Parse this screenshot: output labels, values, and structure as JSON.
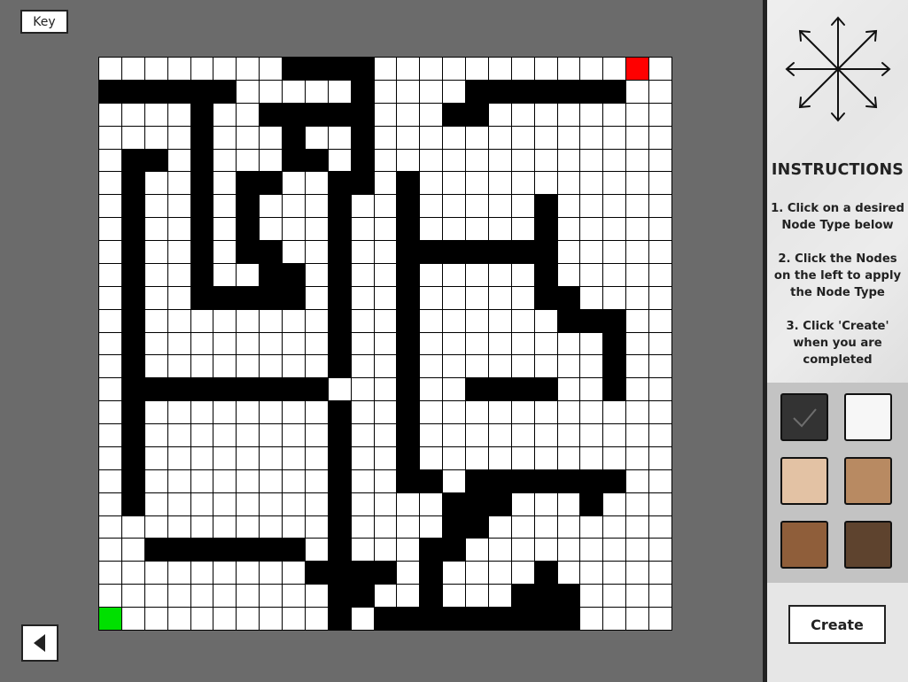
{
  "toolbar": {
    "key_label": "Key",
    "back_icon": "triangle-left-icon"
  },
  "grid": {
    "rows": 25,
    "cols": 25,
    "start_color": "#00e000",
    "end_color": "#ff0000",
    "wall_color": "#000000",
    "empty_color": "#ffffff",
    "legend": "# = wall, . = empty, S = start, E = end",
    "map": [
      "........####...........E.",
      "######.....#....#######..",
      "....#..#####...##........",
      "....#...#..#.............",
      ".##.#...##.#.............",
      ".#..#.##..##.#...........",
      ".#..#.#...#..#.....#.....",
      ".#..#.#...#..#.....#.....",
      ".#..#.##..#..#######.....",
      ".#..#..##.#..#.....#.....",
      ".#..#####.#..#.....##....",
      ".#........#..#......###..",
      ".#........#..#........#..",
      ".#........#..#........#..",
      ".#########...#..####..#..",
      ".#........#..#...........",
      ".#........#..#...........",
      ".#........#..#...........",
      ".#........#..##.#######..",
      ".#........#....###...#...",
      "..........#....##........",
      "..#######.#...##.........",
      ".........####.#....#.....",
      "..........##..#...###....",
      "S.........#.#########...."
    ]
  },
  "compass": {
    "icon": "eight-direction-arrows-icon"
  },
  "instructions": {
    "title": "INSTRUCTIONS",
    "step1": "1. Click on a desired Node Type below",
    "step2": "2. Click the Nodes on the left to apply the Node Type",
    "step3": "3. Click 'Create' when you are completed"
  },
  "palette": {
    "swatches": [
      {
        "name": "wall",
        "color": "#333333",
        "icon": "checkmark-icon",
        "selected": true
      },
      {
        "name": "empty",
        "color": "#f7f7f7"
      },
      {
        "name": "terrain-1",
        "color": "#e3c2a4"
      },
      {
        "name": "terrain-2",
        "color": "#b88a62"
      },
      {
        "name": "terrain-3",
        "color": "#8f5e3a"
      },
      {
        "name": "terrain-4",
        "color": "#5e432e"
      }
    ]
  },
  "footer": {
    "create_label": "Create"
  }
}
